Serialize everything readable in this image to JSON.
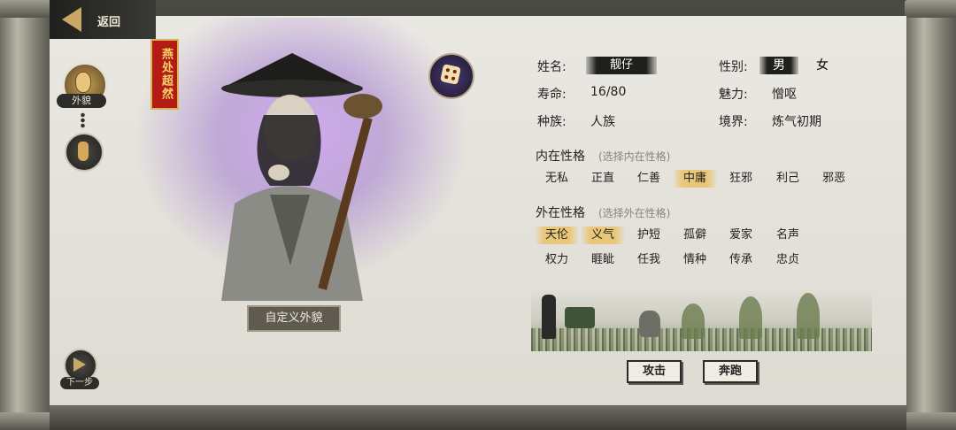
{
  "nav": {
    "back_label": "返回"
  },
  "left_panel": {
    "appearance_label": "外貌",
    "next_label": "下一步",
    "custom_appearance_label": "自定义外貌",
    "seal_text": "燕处超然"
  },
  "profile": {
    "name_label": "姓名:",
    "name_value": "靓仔",
    "gender_label": "性别:",
    "gender_options": [
      "男",
      "女"
    ],
    "gender_selected": "男",
    "lifespan_label": "寿命:",
    "lifespan_value": "16/80",
    "charm_label": "魅力:",
    "charm_value": "憎呕",
    "race_label": "种族:",
    "race_value": "人族",
    "realm_label": "境界:",
    "realm_value": "炼气初期"
  },
  "inner_personality": {
    "title": "内在性格",
    "hint": "(选择内在性格)",
    "traits": [
      "无私",
      "正直",
      "仁善",
      "中庸",
      "狂邪",
      "利己",
      "邪恶"
    ],
    "selected": [
      "中庸"
    ]
  },
  "outer_personality": {
    "title": "外在性格",
    "hint": "(选择外在性格)",
    "traits_row1": [
      "天伦",
      "义气",
      "护短",
      "孤僻",
      "爱家",
      "名声"
    ],
    "traits_row2": [
      "权力",
      "睚眦",
      "任我",
      "情种",
      "传承",
      "忠贞"
    ],
    "selected": [
      "天伦",
      "义气"
    ]
  },
  "actions": {
    "attack": "攻击",
    "flee": "奔跑"
  },
  "colors": {
    "accent_gold": "#e8c778",
    "dark": "#1f1f1c",
    "seal_red": "#b31c15",
    "aura_purple": "#9a55e0"
  },
  "icons": [
    "back-arrow-icon",
    "face-icon",
    "gourd-icon",
    "dice-icon",
    "next-arrow-icon"
  ]
}
